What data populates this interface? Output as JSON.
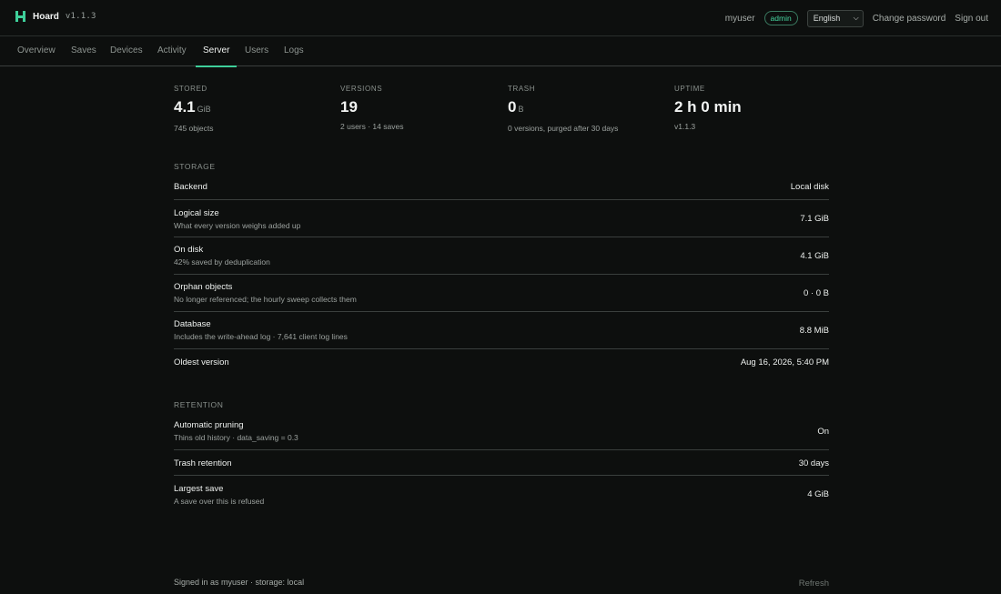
{
  "app": {
    "name": "Hoard",
    "version": "v1.1.3"
  },
  "user": {
    "name": "myuser",
    "role": "admin"
  },
  "language": {
    "selected": "English"
  },
  "top_links": {
    "change_password": "Change password",
    "sign_out": "Sign out"
  },
  "tabs": [
    {
      "label": "Overview"
    },
    {
      "label": "Saves"
    },
    {
      "label": "Devices"
    },
    {
      "label": "Activity"
    },
    {
      "label": "Server",
      "active": true
    },
    {
      "label": "Users"
    },
    {
      "label": "Logs"
    }
  ],
  "stats": {
    "stored": {
      "label": "STORED",
      "value": "4.1",
      "unit": "GiB",
      "sub": "745 objects"
    },
    "versions": {
      "label": "VERSIONS",
      "value": "19",
      "sub": "2 users · 14 saves"
    },
    "trash": {
      "label": "TRASH",
      "value": "0",
      "unit": "B",
      "sub": "0 versions, purged after 30 days"
    },
    "uptime": {
      "label": "UPTIME",
      "value": "2 h 0 min",
      "sub": "v1.1.3"
    }
  },
  "storage": {
    "label": "STORAGE",
    "rows": [
      {
        "title": "Backend",
        "sub": "",
        "value": "Local disk"
      },
      {
        "title": "Logical size",
        "sub": "What every version weighs added up",
        "value": "7.1 GiB"
      },
      {
        "title": "On disk",
        "sub": "42% saved by deduplication",
        "value": "4.1 GiB"
      },
      {
        "title": "Orphan objects",
        "sub": "No longer referenced; the hourly sweep collects them",
        "value": "0 · 0 B"
      },
      {
        "title": "Database",
        "sub": "Includes the write-ahead log · 7,641 client log lines",
        "value": "8.8 MiB"
      },
      {
        "title": "Oldest version",
        "sub": "",
        "value": "Aug 16, 2026, 5:40 PM"
      }
    ]
  },
  "retention": {
    "label": "RETENTION",
    "rows": [
      {
        "title": "Automatic pruning",
        "sub": "Thins old history · data_saving = 0.3",
        "value": "On"
      },
      {
        "title": "Trash retention",
        "sub": "",
        "value": "30 days"
      },
      {
        "title": "Largest save",
        "sub": "A save over this is refused",
        "value": "4 GiB"
      }
    ]
  },
  "footer": {
    "text": "Signed in as myuser · storage: local",
    "refresh": "Refresh"
  },
  "colors": {
    "accent": "#3ecf9a",
    "background": "#0d0f0e"
  }
}
